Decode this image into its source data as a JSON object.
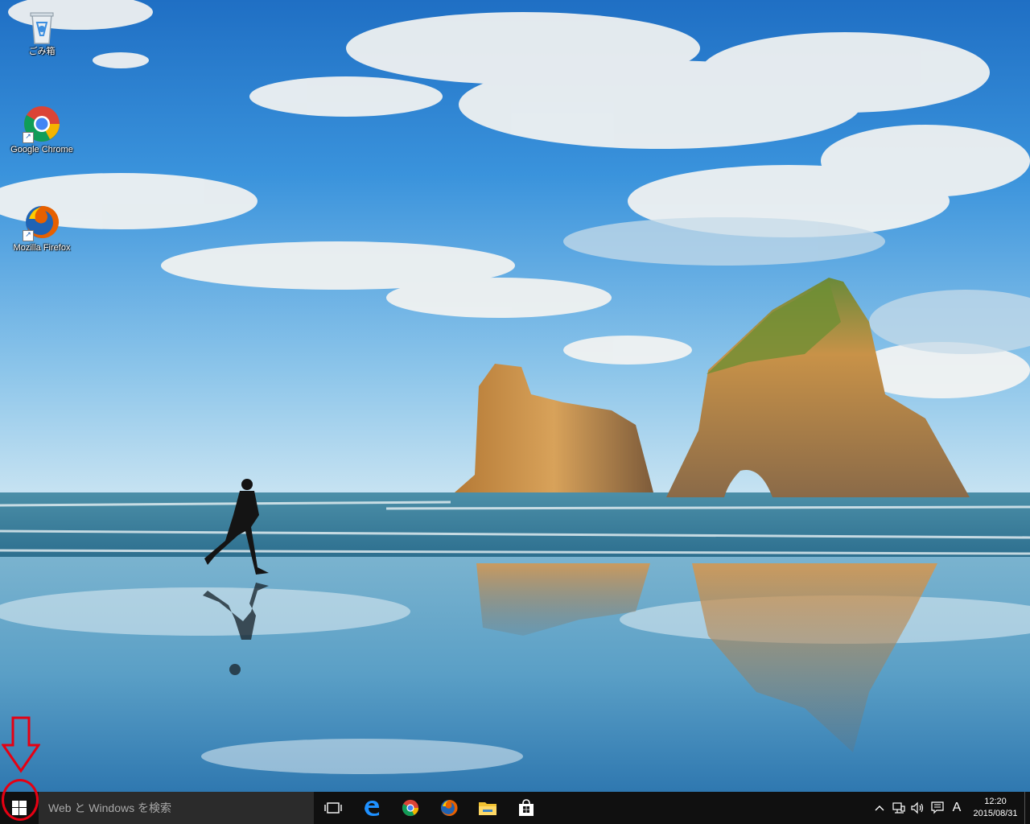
{
  "desktop": {
    "icons": [
      {
        "label": "ごみ箱",
        "icon": "recycle-bin-icon"
      },
      {
        "label": "Google Chrome",
        "icon": "chrome-icon"
      },
      {
        "label": "Mozilla Firefox",
        "icon": "firefox-icon"
      }
    ]
  },
  "taskbar": {
    "search": {
      "placeholder": "Web と Windows を検索"
    },
    "pinned": [
      {
        "name": "task-view",
        "icon": "task-view-icon"
      },
      {
        "name": "edge",
        "icon": "edge-icon"
      },
      {
        "name": "chrome",
        "icon": "chrome-icon"
      },
      {
        "name": "firefox",
        "icon": "firefox-icon"
      },
      {
        "name": "file-explorer",
        "icon": "folder-icon"
      },
      {
        "name": "store",
        "icon": "store-icon"
      }
    ],
    "tray": {
      "chevron": "^",
      "ime": "A",
      "time": "12:20",
      "date": "2015/08/31"
    }
  },
  "colors": {
    "taskbar": "#101010",
    "search_bg": "#2b2b2b",
    "annotation": "#e60012",
    "accent": "#0078d7"
  }
}
